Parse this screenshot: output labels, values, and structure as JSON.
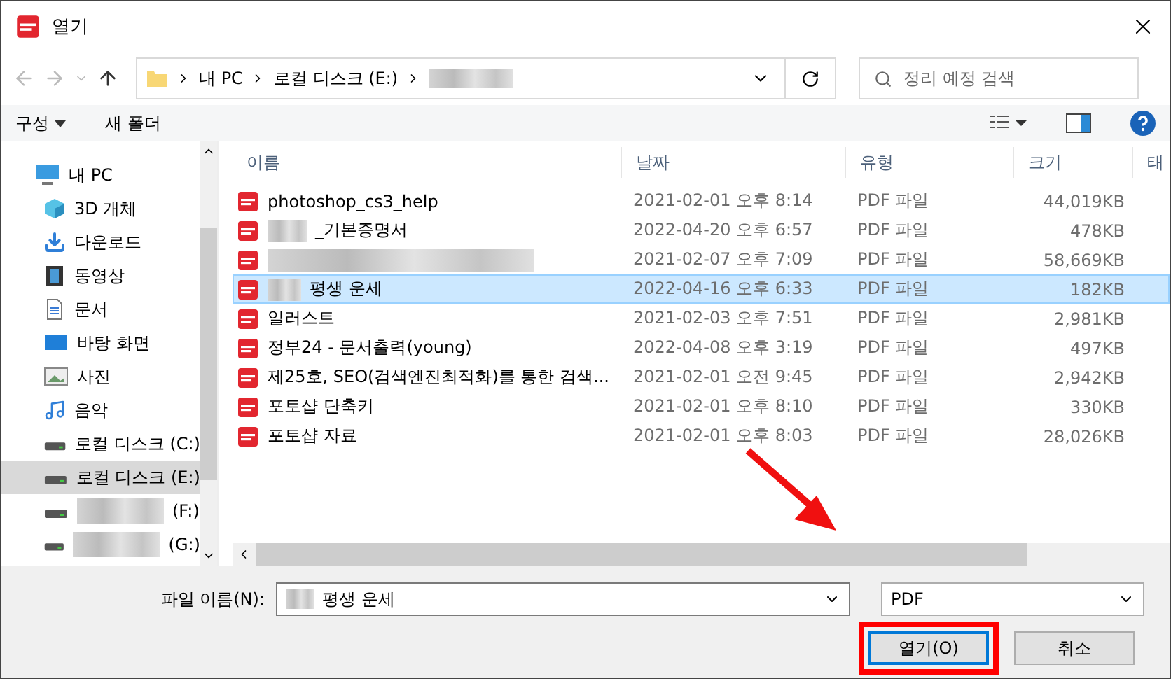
{
  "window": {
    "title": "열기"
  },
  "address": {
    "crumbs": [
      "내 PC",
      "로컬 디스크 (E:)"
    ],
    "redacted_tail": true
  },
  "search": {
    "placeholder": "정리 예정 검색"
  },
  "toolbar": {
    "organize": "구성",
    "new_folder": "새 폴더"
  },
  "sidebar": {
    "items": [
      {
        "label": "내 PC",
        "kind": "pc",
        "selected": false,
        "redacted": false
      },
      {
        "label": "3D 개체",
        "kind": "cube",
        "selected": false,
        "redacted": false
      },
      {
        "label": "다운로드",
        "kind": "download",
        "selected": false,
        "redacted": false
      },
      {
        "label": "동영상",
        "kind": "video",
        "selected": false,
        "redacted": false
      },
      {
        "label": "문서",
        "kind": "doc",
        "selected": false,
        "redacted": false
      },
      {
        "label": "바탕 화면",
        "kind": "desktop",
        "selected": false,
        "redacted": false
      },
      {
        "label": "사진",
        "kind": "photo",
        "selected": false,
        "redacted": false
      },
      {
        "label": "음악",
        "kind": "music",
        "selected": false,
        "redacted": false
      },
      {
        "label": "로컬 디스크 (C:)",
        "kind": "drive",
        "selected": false,
        "redacted": false
      },
      {
        "label": "로컬 디스크 (E:)",
        "kind": "drive",
        "selected": true,
        "redacted": false
      },
      {
        "label": "(F:)",
        "kind": "drive",
        "selected": false,
        "redacted": true
      },
      {
        "label": "(G:)",
        "kind": "drive",
        "selected": false,
        "redacted": true
      }
    ]
  },
  "table": {
    "columns": [
      "이름",
      "날짜",
      "유형",
      "크기",
      "태"
    ],
    "rows": [
      {
        "name": "photoshop_cs3_help",
        "redacted": false,
        "date": "2021-02-01 오후 8:14",
        "type": "PDF 파일",
        "size": "44,019KB",
        "selected": false
      },
      {
        "name": "_기본증명서",
        "redacted": true,
        "date": "2022-04-20 오후 6:57",
        "type": "PDF 파일",
        "size": "478KB",
        "selected": false
      },
      {
        "redacted": true,
        "date": "2021-02-07 오후 7:09",
        "type": "PDF 파일",
        "size": "58,669KB",
        "selected": false
      },
      {
        "name": "평생 운세",
        "redacted": true,
        "date": "2022-04-16 오후 6:33",
        "type": "PDF 파일",
        "size": "182KB",
        "selected": true
      },
      {
        "name": "일러스트",
        "redacted": false,
        "date": "2021-02-03 오후 7:51",
        "type": "PDF 파일",
        "size": "2,981KB",
        "selected": false
      },
      {
        "name": "정부24 - 문서출력(young)",
        "redacted": false,
        "date": "2022-04-08 오후 3:19",
        "type": "PDF 파일",
        "size": "497KB",
        "selected": false
      },
      {
        "name": "제25호, SEO(검색엔진최적화)를 통한 검색...",
        "redacted": false,
        "date": "2021-02-01 오전 9:45",
        "type": "PDF 파일",
        "size": "2,942KB",
        "selected": false
      },
      {
        "name": "포토샵 단축키",
        "redacted": false,
        "date": "2021-02-01 오후 8:10",
        "type": "PDF 파일",
        "size": "330KB",
        "selected": false
      },
      {
        "name": "포토샵 자료",
        "redacted": false,
        "date": "2021-02-01 오후 8:03",
        "type": "PDF 파일",
        "size": "28,026KB",
        "selected": false
      }
    ]
  },
  "footer": {
    "filename_label": "파일 이름(N):",
    "filename": "평생 운세",
    "filename_redacted": true,
    "filter": "PDF",
    "buttons": [
      {
        "label": "열기(O)",
        "highlighted": true,
        "default": true
      },
      {
        "label": "취소",
        "highlighted": false,
        "default": false
      }
    ]
  },
  "annotation": {
    "kind": "arrow"
  }
}
